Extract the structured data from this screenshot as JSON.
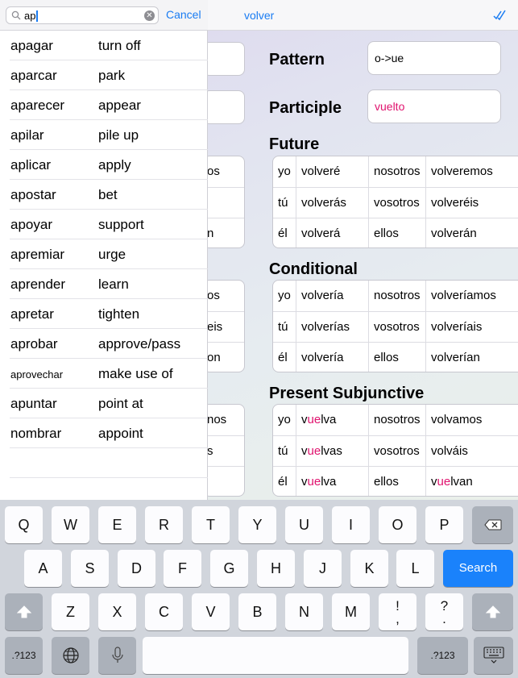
{
  "nav": {
    "title": "volver"
  },
  "pattern": {
    "label": "Pattern",
    "value": "o->ue"
  },
  "participle": {
    "label": "Participle",
    "value": "vuelto"
  },
  "future": {
    "title": "Future",
    "rows": [
      {
        "p1": "yo",
        "f1": "volveré",
        "p2": "nosotros",
        "f2": "volveremos"
      },
      {
        "p1": "tú",
        "f1": "volverás",
        "p2": "vosotros",
        "f2": "volveréis"
      },
      {
        "p1": "él",
        "f1": "volverá",
        "p2": "ellos",
        "f2": "volverán"
      }
    ]
  },
  "conditional": {
    "title": "Conditional",
    "rows": [
      {
        "p1": "yo",
        "f1": "volvería",
        "p2": "nosotros",
        "f2": "volveríamos"
      },
      {
        "p1": "tú",
        "f1": "volverías",
        "p2": "vosotros",
        "f2": "volveríais"
      },
      {
        "p1": "él",
        "f1": "volvería",
        "p2": "ellos",
        "f2": "volverían"
      }
    ]
  },
  "subjunctive": {
    "title": "Present Subjunctive",
    "rows": [
      {
        "p1": "yo",
        "f1_pre": "v",
        "f1_hl": "ue",
        "f1_post": "lva",
        "p2": "nosotros",
        "f2_pre": "volvamos",
        "f2_hl": "",
        "f2_post": ""
      },
      {
        "p1": "tú",
        "f1_pre": "v",
        "f1_hl": "ue",
        "f1_post": "lvas",
        "p2": "vosotros",
        "f2_pre": "volváis",
        "f2_hl": "",
        "f2_post": ""
      },
      {
        "p1": "él",
        "f1_pre": "v",
        "f1_hl": "ue",
        "f1_post": "lva",
        "p2": "ellos",
        "f2_pre": "v",
        "f2_hl": "ue",
        "f2_post": "lvan"
      }
    ]
  },
  "hidden_column": {
    "future": [
      "os",
      "",
      "n"
    ],
    "conditional": [
      "os",
      "eis",
      "on"
    ],
    "subjunctive": [
      "nos",
      "s",
      ""
    ]
  },
  "search": {
    "query": "ap",
    "cancel_label": "Cancel",
    "results": [
      {
        "es": "apagar",
        "en": "turn off"
      },
      {
        "es": "aparcar",
        "en": "park"
      },
      {
        "es": "aparecer",
        "en": "appear"
      },
      {
        "es": "apilar",
        "en": "pile up"
      },
      {
        "es": "aplicar",
        "en": "apply"
      },
      {
        "es": "apostar",
        "en": "bet"
      },
      {
        "es": "apoyar",
        "en": "support"
      },
      {
        "es": "apremiar",
        "en": "urge"
      },
      {
        "es": "aprender",
        "en": "learn"
      },
      {
        "es": "apretar",
        "en": "tighten"
      },
      {
        "es": "aprobar",
        "en": "approve/pass"
      },
      {
        "es": "aprovechar",
        "en": "make use of"
      },
      {
        "es": "apuntar",
        "en": "point at"
      },
      {
        "es": "nombrar",
        "en": "appoint"
      }
    ]
  },
  "keyboard": {
    "row1": [
      "Q",
      "W",
      "E",
      "R",
      "T",
      "Y",
      "U",
      "I",
      "O",
      "P"
    ],
    "row2": [
      "A",
      "S",
      "D",
      "F",
      "G",
      "H",
      "J",
      "K",
      "L"
    ],
    "row3": [
      "Z",
      "X",
      "C",
      "V",
      "B",
      "N",
      "M"
    ],
    "exclam_top": "!",
    "exclam_bottom": ",",
    "question_top": "?",
    "question_bottom": ".",
    "search_label": "Search",
    "numbers_label": ".?123"
  },
  "colors": {
    "accent": "#1a7cf2",
    "highlight": "#e0136e",
    "search_key": "#1a82fb"
  }
}
